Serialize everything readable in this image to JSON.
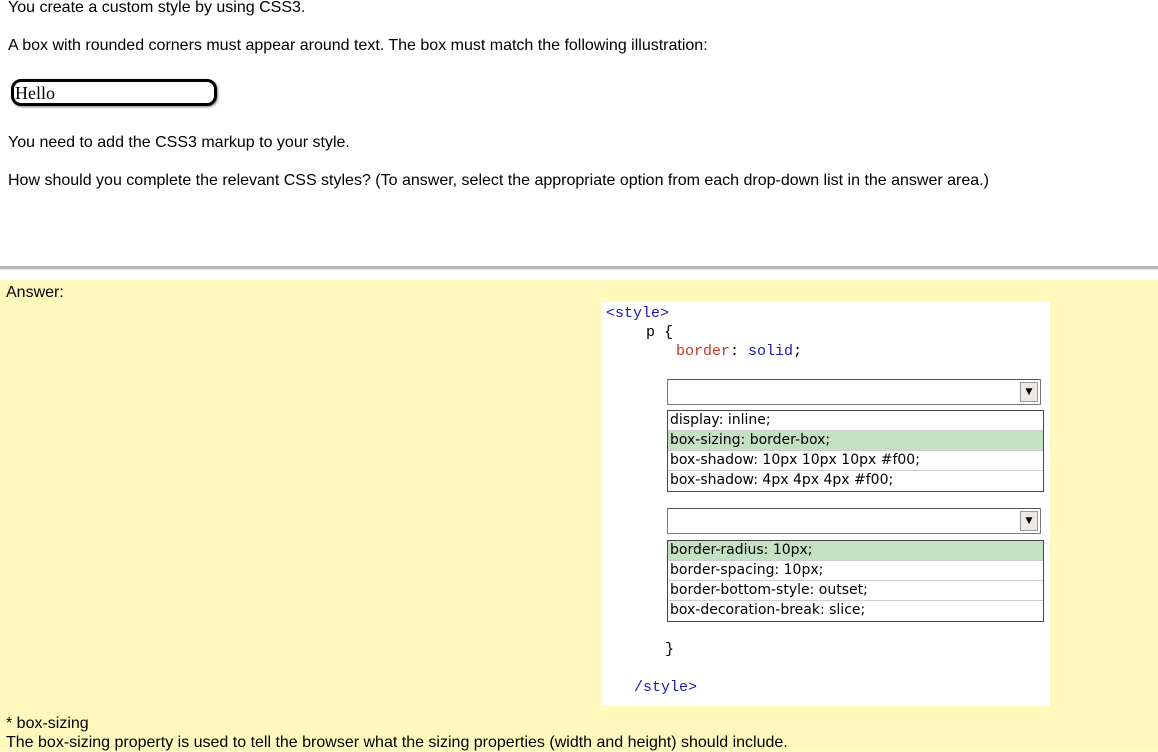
{
  "question": {
    "line1": "You create a custom style by using CSS3.",
    "line2": "A box with rounded corners must appear around text. The box must match the following illustration:",
    "illustration_text": "Hello",
    "line3": "You need to add the CSS3 markup to your style.",
    "line4": "How should you complete the relevant CSS styles? (To answer, select the appropriate option from each drop-down list in the answer area.)"
  },
  "answer": {
    "label": "Answer:",
    "code": {
      "style_open": "<style>",
      "selector": "p {",
      "prop": "border",
      "colon": ":",
      "value": "solid",
      "semicolon": ";",
      "close_brace": "}",
      "style_close": "/style>"
    },
    "dropdown1": {
      "selected": "",
      "options": [
        "display: inline;",
        "box-sizing: border-box;",
        "box-shadow: 10px 10px 10px #f00;",
        "box-shadow: 4px 4px 4px #f00;"
      ],
      "highlighted_index": 1
    },
    "dropdown2": {
      "selected": "",
      "options": [
        "border-radius: 10px;",
        "border-spacing: 10px;",
        "border-bottom-style: outset;",
        "box-decoration-break: slice;"
      ],
      "highlighted_index": 0
    },
    "highlight_color": "#c5e1c4"
  },
  "notes": {
    "title": "* box-sizing",
    "text": "The box-sizing property is used to tell the browser what the sizing properties (width and height) should include."
  }
}
